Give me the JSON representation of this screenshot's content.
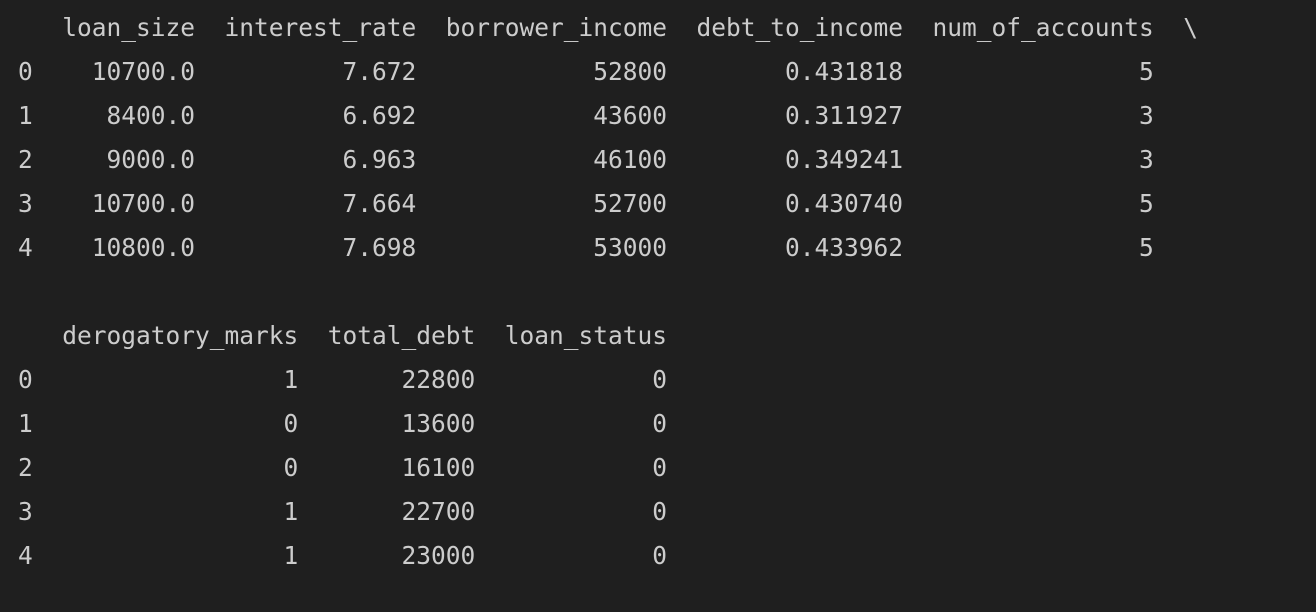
{
  "output": {
    "block1": {
      "header": "   loan_size  interest_rate  borrower_income  debt_to_income  num_of_accounts  \\",
      "rows": [
        "0    10700.0          7.672            52800        0.431818                5",
        "1     8400.0          6.692            43600        0.311927                3",
        "2     9000.0          6.963            46100        0.349241                3",
        "3    10700.0          7.664            52700        0.430740                5",
        "4    10800.0          7.698            53000        0.433962                5"
      ]
    },
    "block2": {
      "header": "   derogatory_marks  total_debt  loan_status",
      "rows": [
        "0                 1       22800            0",
        "1                 0       13600            0",
        "2                 0       16100            0",
        "3                 1       22700            0",
        "4                 1       23000            0"
      ]
    }
  }
}
